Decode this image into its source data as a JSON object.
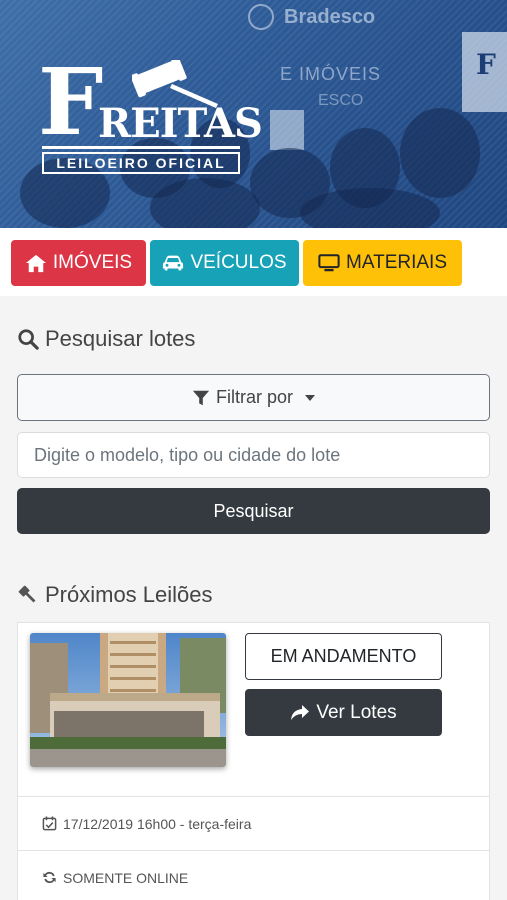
{
  "header": {
    "logo": {
      "initial": "F",
      "name": "REITAS",
      "subtitle": "LEILOEIRO OFICIAL"
    },
    "background_text": {
      "bank": "Bradesco",
      "sign_line1": "E IMÓVEIS",
      "sign_line2": "ESCO"
    }
  },
  "categories": [
    {
      "label": "IMÓVEIS",
      "icon": "home-icon",
      "color": "#dc3545"
    },
    {
      "label": "VEÍCULOS",
      "icon": "car-icon",
      "color": "#17a2b8"
    },
    {
      "label": "MATERIAIS",
      "icon": "monitor-icon",
      "color": "#ffc107"
    }
  ],
  "search": {
    "title": "Pesquisar lotes",
    "title_icon": "search-icon",
    "filter_label": "Filtrar por",
    "filter_icon": "filter-icon",
    "input_value": "",
    "input_placeholder": "Digite o modelo, tipo ou cidade do lote",
    "submit_label": "Pesquisar"
  },
  "upcoming": {
    "title": "Próximos Leilões",
    "title_icon": "gavel-icon",
    "auction": {
      "status_label": "EM ANDAMENTO",
      "view_lots_label": "Ver Lotes",
      "view_lots_icon": "share-arrow-icon",
      "date_text": "17/12/2019 16h00 - terça-feira",
      "date_icon": "calendar-check-icon",
      "mode_text": "SOMENTE ONLINE",
      "mode_icon": "sync-icon"
    }
  },
  "colors": {
    "dark": "#343a40",
    "danger": "#dc3545",
    "info": "#17a2b8",
    "warning": "#ffc107"
  }
}
